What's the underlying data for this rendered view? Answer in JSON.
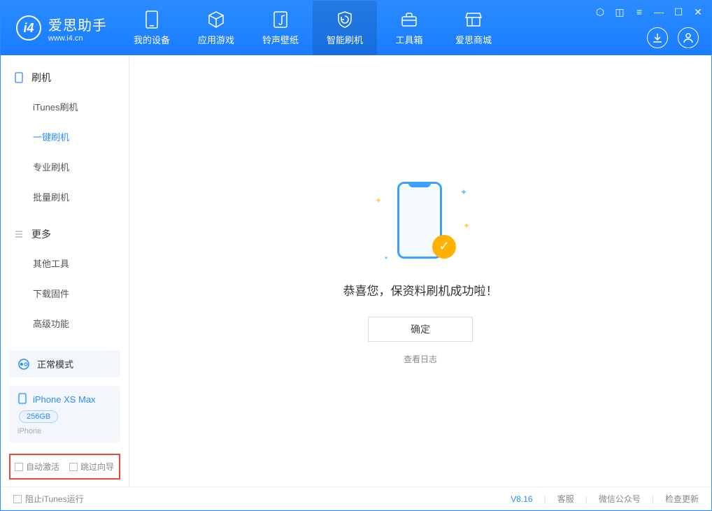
{
  "app": {
    "name_cn": "爱思助手",
    "name_en": "www.i4.cn"
  },
  "nav": [
    {
      "label": "我的设备",
      "icon": "device"
    },
    {
      "label": "应用游戏",
      "icon": "cube"
    },
    {
      "label": "铃声壁纸",
      "icon": "music"
    },
    {
      "label": "智能刷机",
      "icon": "shield",
      "active": true
    },
    {
      "label": "工具箱",
      "icon": "toolbox"
    },
    {
      "label": "爱思商城",
      "icon": "shop"
    }
  ],
  "sidebar": {
    "section1": {
      "title": "刷机",
      "items": [
        "iTunes刷机",
        "一键刷机",
        "专业刷机",
        "批量刷机"
      ],
      "active_index": 1
    },
    "section2": {
      "title": "更多",
      "items": [
        "其他工具",
        "下载固件",
        "高级功能"
      ]
    }
  },
  "mode": {
    "label": "正常模式"
  },
  "device": {
    "name": "iPhone XS Max",
    "storage": "256GB",
    "type": "iPhone"
  },
  "bottom_options": {
    "auto_activate": "自动激活",
    "skip_guide": "跳过向导"
  },
  "result": {
    "message": "恭喜您，保资料刷机成功啦！",
    "ok_label": "确定",
    "log_link": "查看日志"
  },
  "footer": {
    "block_itunes": "阻止iTunes运行",
    "version": "V8.16",
    "links": [
      "客服",
      "微信公众号",
      "检查更新"
    ]
  }
}
